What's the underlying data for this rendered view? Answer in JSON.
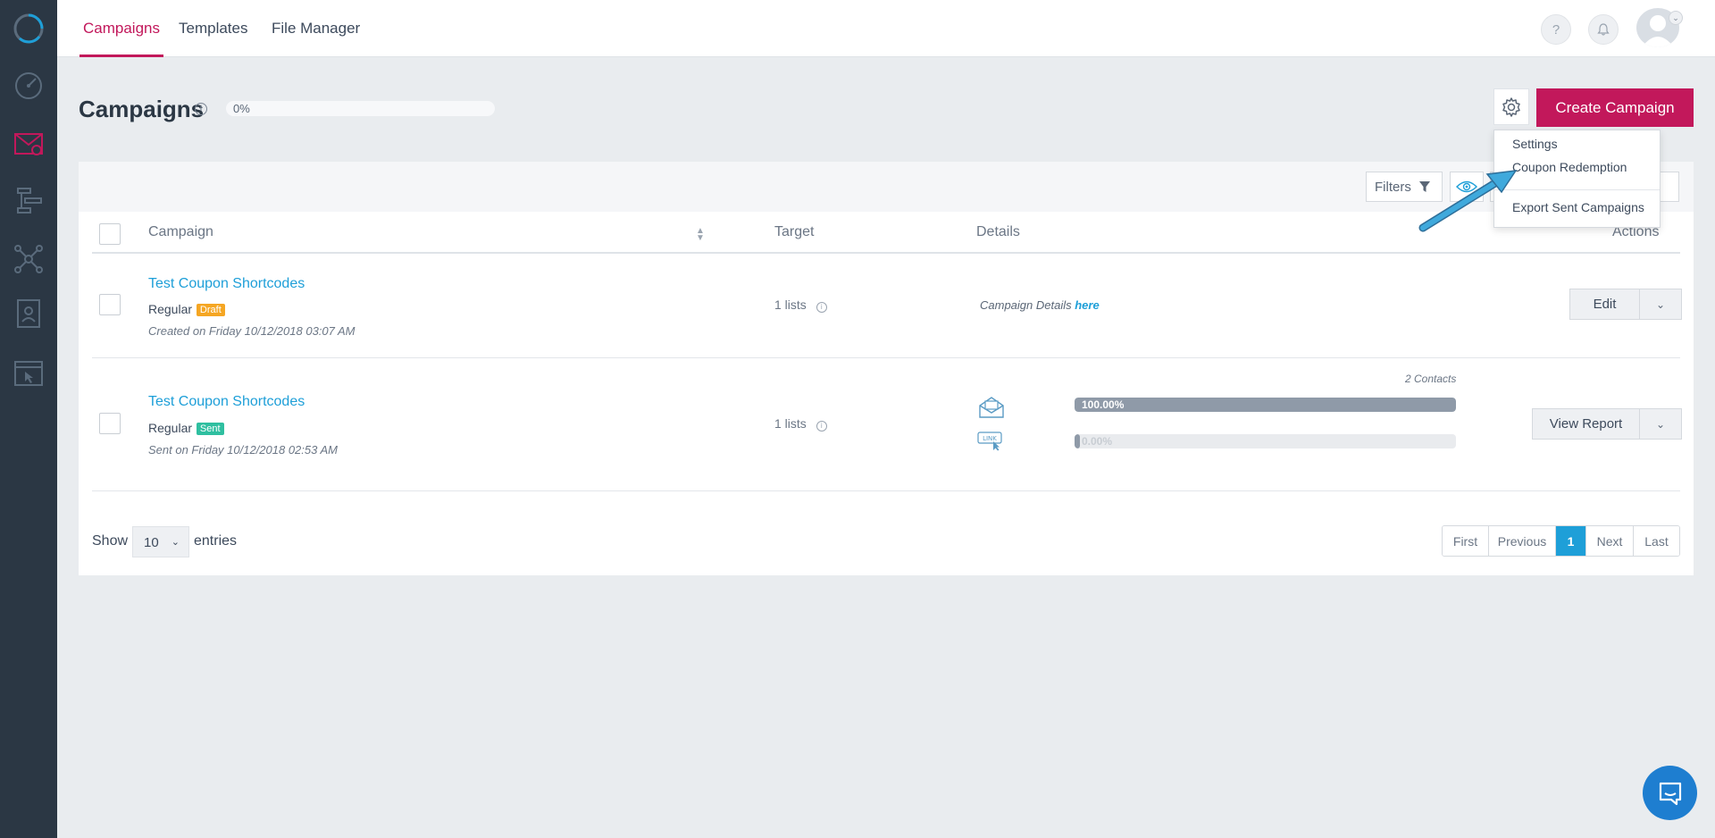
{
  "nav": {
    "tabs": [
      {
        "label": "Campaigns"
      },
      {
        "label": "Templates"
      },
      {
        "label": "File Manager"
      }
    ],
    "help_icon": "question-icon",
    "bell_icon": "bell-icon",
    "avatar_icon": "user-avatar"
  },
  "sidebar": {
    "items": [
      "logo-icon",
      "dashboard-icon",
      "campaigns-icon",
      "automation-icon",
      "network-icon",
      "contacts-icon",
      "landing-page-icon"
    ]
  },
  "header": {
    "title": "Campaigns",
    "progress_label": "0%",
    "create_button": "Create Campaign"
  },
  "dropdown": {
    "items": [
      "Settings",
      "Coupon Redemption",
      "Export Sent Campaigns"
    ]
  },
  "toolbar": {
    "filters_label": "Filters"
  },
  "table": {
    "columns": {
      "campaign": "Campaign",
      "target": "Target",
      "details": "Details",
      "actions": "Actions"
    },
    "rows": [
      {
        "name": "Test Coupon Shortcodes",
        "type": "Regular",
        "badge": "Draft",
        "date": "Created on Friday 10/12/2018 03:07 AM",
        "target": "1 lists",
        "details_prefix": "Campaign Details",
        "details_link": "here",
        "action": "Edit"
      },
      {
        "name": "Test Coupon Shortcodes",
        "type": "Regular",
        "badge": "Sent",
        "date": "Sent on Friday 10/12/2018 02:53 AM",
        "target": "1 lists",
        "contacts": "2 Contacts",
        "open_rate_label": "100.00%",
        "open_rate": 1.0,
        "click_rate_label": "0.00%",
        "click_rate": 0.0,
        "link_icon_label": "LINK",
        "action": "View Report"
      }
    ]
  },
  "footer": {
    "show_label": "Show",
    "entries_value": "10",
    "entries_label": "entries",
    "pager": {
      "first": "First",
      "previous": "Previous",
      "current": "1",
      "next": "Next",
      "last": "Last"
    }
  },
  "colors": {
    "accent": "#c2185b",
    "link": "#1e9fd8",
    "sidebar": "#2b3744"
  }
}
